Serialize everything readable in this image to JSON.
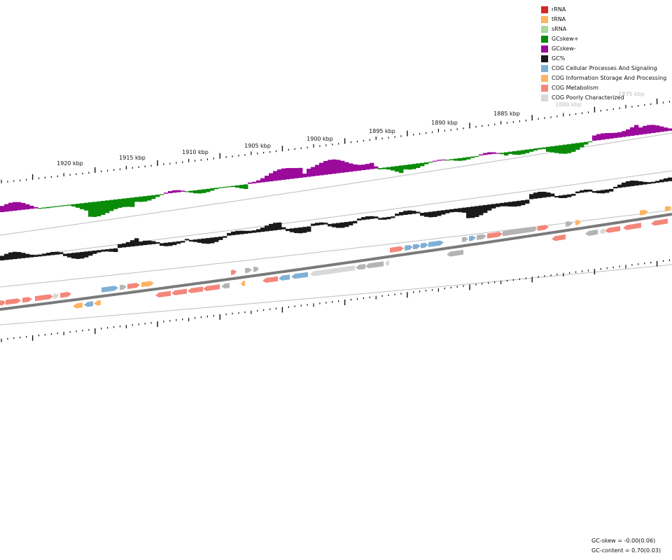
{
  "legend": [
    {
      "label": "rRNA",
      "color": "#d62728"
    },
    {
      "label": "tRNA",
      "color": "#fdb462"
    },
    {
      "label": "sRNA",
      "color": "#a6d99b"
    },
    {
      "label": "GCskew+",
      "color": "#0a8c0a"
    },
    {
      "label": "GCskew-",
      "color": "#9b0a9b"
    },
    {
      "label": "GC%",
      "color": "#1a1a1a"
    },
    {
      "label": "COG Cellular Processes And Signaling",
      "color": "#7fb0d6"
    },
    {
      "label": "COG Information Storage And Processing",
      "color": "#fdb462"
    },
    {
      "label": "COG Metabolism",
      "color": "#f4877a"
    },
    {
      "label": "COG Poorly Characterized",
      "color": "#d8d8d8"
    }
  ],
  "kbp_labels": [
    "1920 kbp",
    "1915 kbp",
    "1910 kbp",
    "1905 kbp",
    "1900 kbp",
    "1895 kbp",
    "1890 kbp",
    "1885 kbp",
    "1880 kbp",
    "1875 kbp"
  ],
  "stats": {
    "gc_skew": "GC-skew = -0.00(0.06)",
    "gc_content": "GC-content = 0.70(0.03)"
  },
  "colors": {
    "skew_pos": "#0a8c0a",
    "skew_neg": "#9b0a9b",
    "gc": "#1a1a1a",
    "cog_cellular": "#7fb0d6",
    "cog_info": "#fdb462",
    "cog_metab": "#f4877a",
    "cog_poor": "#d8d8d8",
    "gray_gene": "#b4b4b4",
    "backbone": "#7a7a7a"
  }
}
